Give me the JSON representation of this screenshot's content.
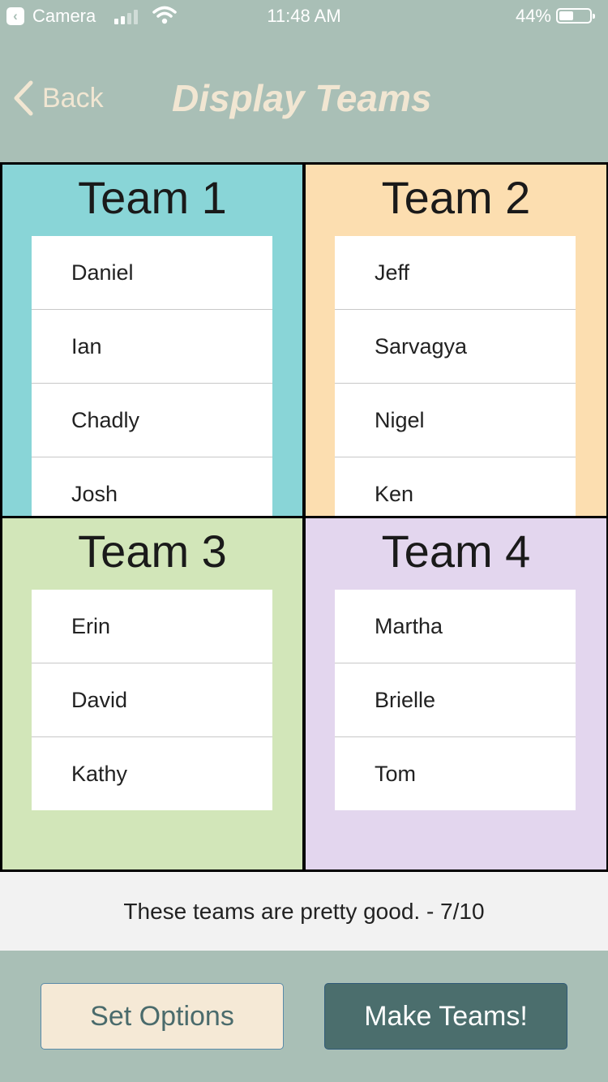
{
  "status_bar": {
    "back_app_label": "Camera",
    "time": "11:48 AM",
    "battery": "44%",
    "battery_level": 0.44
  },
  "nav": {
    "back_label": "Back",
    "title": "Display Teams"
  },
  "teams": [
    {
      "name": "Team 1",
      "color": "#89d5d7",
      "members": [
        "Daniel",
        "Ian",
        "Chadly",
        "Josh"
      ]
    },
    {
      "name": "Team 2",
      "color": "#fcdeb0",
      "members": [
        "Jeff",
        "Sarvagya",
        "Nigel",
        "Ken"
      ]
    },
    {
      "name": "Team 3",
      "color": "#d2e6b9",
      "members": [
        "Erin",
        "David",
        "Kathy"
      ]
    },
    {
      "name": "Team 4",
      "color": "#e3d6ee",
      "members": [
        "Martha",
        "Brielle",
        "Tom"
      ]
    }
  ],
  "rating": "These teams are pretty good. - 7/10",
  "buttons": {
    "set_options": "Set Options",
    "make_teams": "Make Teams!"
  },
  "colors": {
    "background": "#a9bfb6",
    "nav_text": "#f1e6d2",
    "primary_button": "#4b6e6d"
  }
}
